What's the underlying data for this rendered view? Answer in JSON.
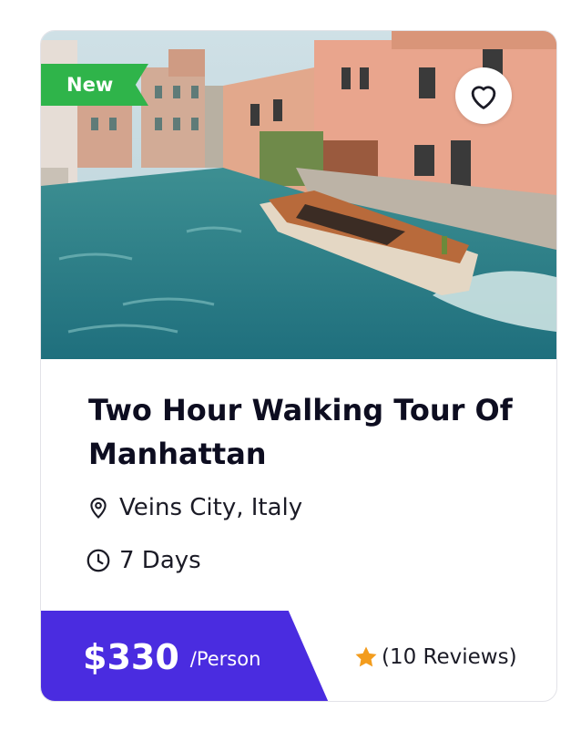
{
  "tour": {
    "badge": "New",
    "title": "Two Hour Walking Tour Of Manhattan",
    "location": "Veins City, Italy",
    "duration": "7 Days",
    "price": "$330",
    "price_unit": "/Person",
    "reviews": "(10 Reviews)"
  },
  "icons": {
    "favorite": "heart-icon",
    "location": "map-pin-icon",
    "duration": "clock-icon",
    "rating": "star-icon"
  },
  "colors": {
    "badge": "#2fb44a",
    "price_bar": "#4a2ce0",
    "star": "#f39c1d",
    "title": "#0d0d20"
  }
}
